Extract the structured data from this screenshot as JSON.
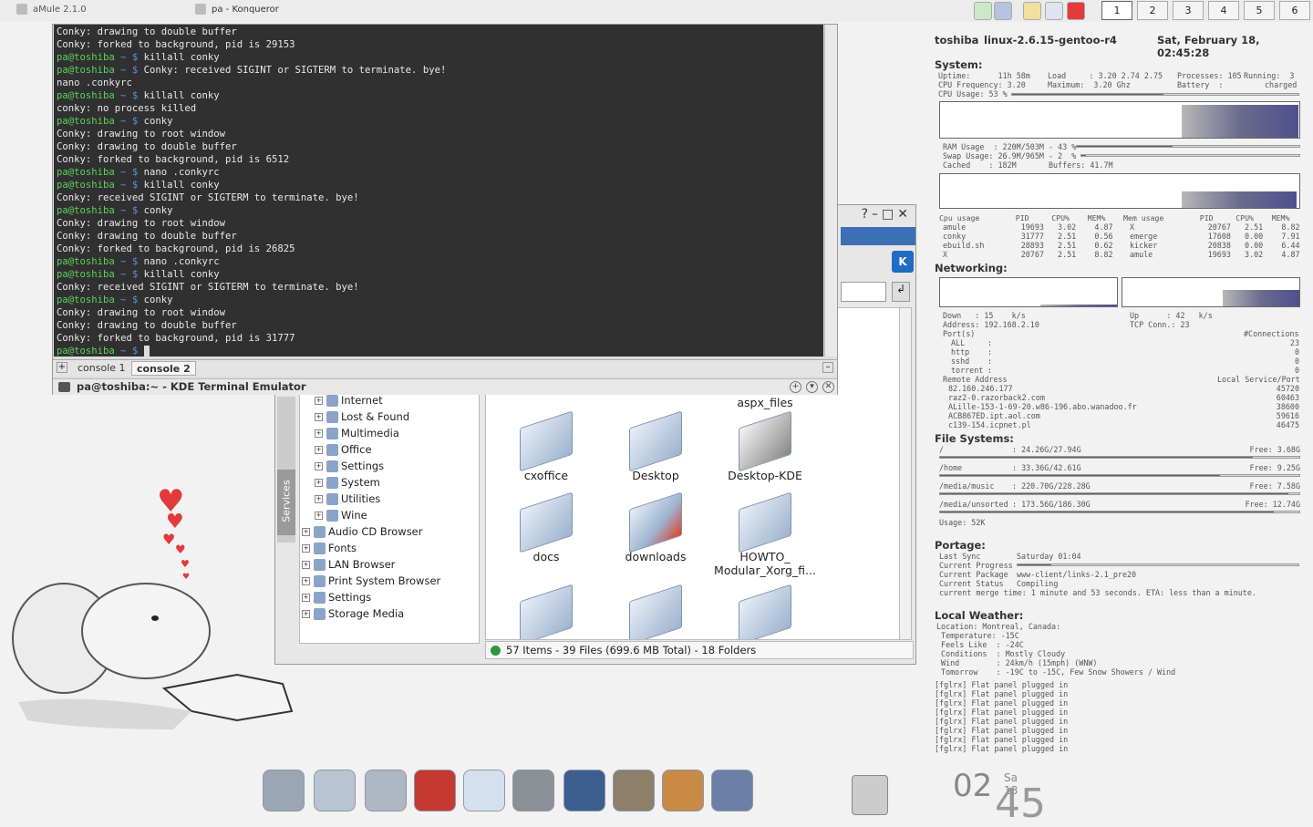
{
  "taskbar": {
    "tasks": [
      {
        "label": "aMule 2.1.0",
        "icon": "amule-icon"
      },
      {
        "label": "pa - Konqueror",
        "icon": "konqueror-icon"
      }
    ],
    "desktops": [
      "1",
      "2",
      "3",
      "4",
      "5",
      "6"
    ],
    "active_desktop": "1"
  },
  "terminal": {
    "lines": [
      {
        "t": "out",
        "text": "Conky: drawing to double buffer"
      },
      {
        "t": "out",
        "text": "Conky: forked to background, pid is 29153"
      },
      {
        "t": "cmd",
        "text": "killall conky"
      },
      {
        "t": "cmd",
        "text": "Conky: received SIGINT or SIGTERM to terminate. bye!"
      },
      {
        "t": "out",
        "text": "nano .conkyrc"
      },
      {
        "t": "cmd",
        "text": "killall conky"
      },
      {
        "t": "out",
        "text": "conky: no process killed"
      },
      {
        "t": "cmd",
        "text": "conky"
      },
      {
        "t": "out",
        "text": "Conky: drawing to root window"
      },
      {
        "t": "out",
        "text": "Conky: drawing to double buffer"
      },
      {
        "t": "out",
        "text": "Conky: forked to background, pid is 6512"
      },
      {
        "t": "cmd",
        "text": "nano .conkyrc"
      },
      {
        "t": "cmd",
        "text": "killall conky"
      },
      {
        "t": "out",
        "text": "Conky: received SIGINT or SIGTERM to terminate. bye!"
      },
      {
        "t": "cmd",
        "text": "conky"
      },
      {
        "t": "out",
        "text": "Conky: drawing to root window"
      },
      {
        "t": "out",
        "text": "Conky: drawing to double buffer"
      },
      {
        "t": "out",
        "text": "Conky: forked to background, pid is 26825"
      },
      {
        "t": "cmd",
        "text": "nano .conkyrc"
      },
      {
        "t": "cmd",
        "text": "killall conky"
      },
      {
        "t": "out",
        "text": "Conky: received SIGINT or SIGTERM to terminate. bye!"
      },
      {
        "t": "cmd",
        "text": "conky"
      },
      {
        "t": "out",
        "text": "Conky: drawing to root window"
      },
      {
        "t": "out",
        "text": "Conky: drawing to double buffer"
      },
      {
        "t": "out",
        "text": "Conky: forked to background, pid is 31777"
      },
      {
        "t": "cmd",
        "text": ""
      }
    ],
    "prompt_user": "pa@toshiba",
    "prompt_path": " ~ $ ",
    "tabs": [
      "console 1",
      "console 2"
    ],
    "active_tab": "console 2",
    "title": "pa@toshiba:~ - KDE Terminal Emulator"
  },
  "konqueror": {
    "tree": [
      "Internet",
      "Lost & Found",
      "Multimedia",
      "Office",
      "Settings",
      "System",
      "Utilities",
      "Wine",
      "Audio CD Browser",
      "Fonts",
      "LAN Browser",
      "Print System Browser",
      "Settings",
      "Storage Media"
    ],
    "services_tab": "Services",
    "files": [
      "aspx_files",
      "cxoffice",
      "Desktop",
      "Desktop-KDE",
      "docs",
      "downloads",
      "HOWTO_",
      "Modular_Xorg_fi..."
    ],
    "status": "57 Items - 39 Files (699.6 MB Total) - 18 Folders"
  },
  "conky": {
    "host": "toshiba",
    "kernel": "linux-2.6.15-gentoo-r4",
    "datetime": "Sat, February 18, 02:45:28",
    "system_head": "System:",
    "uptime": "Uptime:      11h 58m",
    "load": "Load     : 3.20 2.74 2.75",
    "processes": "Processes: 105",
    "running": "Running:  3",
    "cpu_freq": "CPU Frequency: 3.20",
    "maximum": "Maximum:  3.20 Ghz",
    "battery": "Battery  :",
    "battery_val": "charged",
    "cpu_usage": "CPU Usage: 53 %",
    "cpu_usage_pct": 53,
    "ram_usage": "RAM Usage  : 220M/503M - 43 %",
    "ram_pct": 43,
    "swap_usage": "Swap Usage: 26.9M/965M - 2  %",
    "swap_pct": 2,
    "cached": "Cached    : 182M       Buffers: 41.7M",
    "proc_cpu_head": "Cpu usage        PID     CPU%    MEM%",
    "proc_cpu_rows": [
      "amule            19693   3.02    4.87",
      "conky            31777   2.51    0.56",
      "ebuild.sh        28893   2.51    0.62",
      "X                20767   2.51    8.82"
    ],
    "proc_mem_head": "Mem usage        PID     CPU%    MEM%",
    "proc_mem_rows": [
      "X                20767   2.51    8.82",
      "emerge           17608   0.00    7.91",
      "kicker           20838   0.00    6.44",
      "amule            19693   3.02    4.87"
    ],
    "networking_head": "Networking:",
    "down": "Down   : 15    k/s",
    "up": "Up      : 42   k/s",
    "address": "Address: 192.168.2.10",
    "tcp": "TCP Conn.: 23",
    "ports_head": "Port(s)",
    "connections_head": "#Connections",
    "ports": [
      {
        "name": "ALL",
        "n": "23"
      },
      {
        "name": "http",
        "n": "0"
      },
      {
        "name": "sshd",
        "n": "0"
      },
      {
        "name": "torrent",
        "n": "0"
      }
    ],
    "remote_head": "Remote Address",
    "local_head": "Local Service/Port",
    "remotes": [
      {
        "addr": "82.160.246.177",
        "port": "45720"
      },
      {
        "addr": "raz2-0.razorback2.com",
        "port": "60463"
      },
      {
        "addr": "ALille-153-1-69-20.w86-196.abo.wanadoo.fr",
        "port": "38600"
      },
      {
        "addr": "ACB867ED.ipt.aol.com",
        "port": "59616"
      },
      {
        "addr": "c139-154.icpnet.pl",
        "port": "46475"
      }
    ],
    "fs_head": "File Systems:",
    "fs": [
      {
        "mount": "/",
        "usage": ": 24.26G/27.94G",
        "free": "Free: 3.68G",
        "pct": 87
      },
      {
        "mount": "/home",
        "usage": ": 33.36G/42.61G",
        "free": "Free: 9.25G",
        "pct": 78
      },
      {
        "mount": "/media/music",
        "usage": ": 220.70G/228.28G",
        "free": "Free: 7.58G",
        "pct": 97
      },
      {
        "mount": "/media/unsorted",
        "usage": ": 173.56G/186.30G",
        "free": "Free: 12.74G",
        "pct": 93
      }
    ],
    "fs_usage": "Usage: 52K",
    "portage_head": "Portage:",
    "last_sync_k": "Last Sync",
    "last_sync_v": "Saturday 01:04",
    "progress_k": "Current Progress",
    "progress_pct": 12,
    "package_k": "Current Package",
    "package_v": "www-client/links-2.1_pre20",
    "status_k": "Current Status",
    "status_v": "Compiling",
    "merge": "current merge time: 1 minute and 53 seconds. ETA: less than a minute.",
    "weather_head": "Local Weather:",
    "weather": [
      "Location: Montreal, Canada:",
      " Temperature: -15C",
      " Feels Like  : -24C",
      " Conditions  : Mostly Cloudy",
      " Wind        : 24km/h (15mph) (WNW)",
      " Tomorrow    : -19C to -15C, Few Snow Showers / Wind"
    ],
    "log": [
      "[fglrx] Flat panel plugged in",
      "[fglrx] Flat panel plugged in",
      "[fglrx] Flat panel plugged in",
      "[fglrx] Flat panel plugged in",
      "[fglrx] Flat panel plugged in",
      "[fglrx] Flat panel plugged in",
      "[fglrx] Flat panel plugged in",
      "[fglrx] Flat panel plugged in"
    ]
  },
  "clock": {
    "hour": "02",
    "minute": "45",
    "day": "Sa 18"
  },
  "dock": [
    "kmenu-icon",
    "home-icon",
    "search-icon",
    "mail-icon",
    "browser-icon",
    "terminal-icon",
    "wolf-icon",
    "film-icon",
    "amule-icon",
    "chestnut-icon"
  ]
}
